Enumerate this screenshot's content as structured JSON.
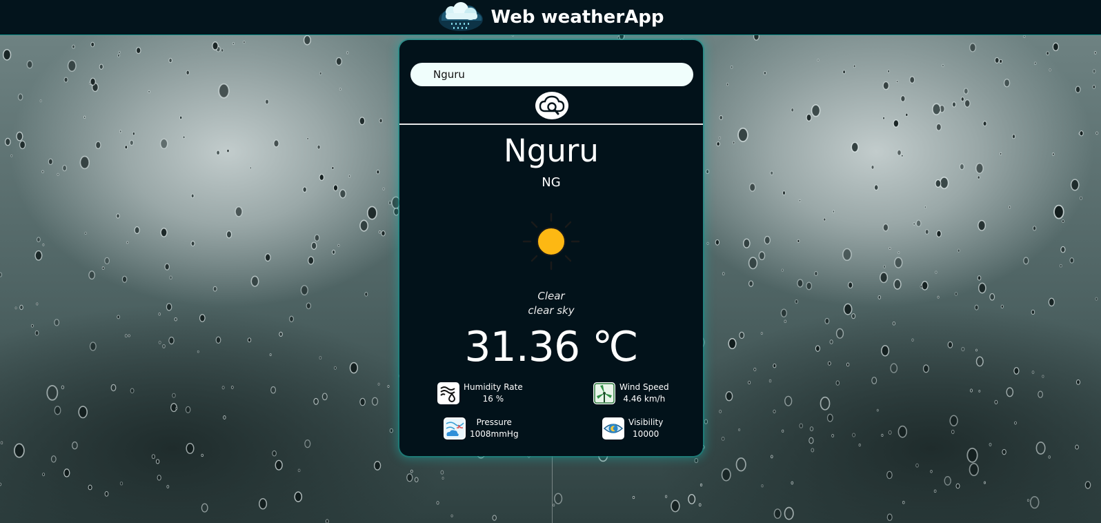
{
  "header": {
    "title": "Web weatherApp",
    "logo_icon": "cloud-rain-icon"
  },
  "search": {
    "value": "Nguru",
    "button_icon": "cloud-search-icon"
  },
  "location": {
    "city": "Nguru",
    "country": "NG"
  },
  "weather": {
    "icon": "sun-icon",
    "main": "Clear",
    "description": "clear sky",
    "temperature": "31.36 ℃"
  },
  "stats": {
    "humidity": {
      "label": "Humidity Rate",
      "value": "16 %",
      "icon": "humidity-icon"
    },
    "wind": {
      "label": "Wind Speed",
      "value": "4.46 km/h",
      "icon": "wind-turbine-icon"
    },
    "pressure": {
      "label": "Pressure",
      "value": "1008mmHg",
      "icon": "pressure-map-icon"
    },
    "visibility": {
      "label": "Visibility",
      "value": "10000",
      "icon": "eye-icon"
    }
  },
  "colors": {
    "topbar": "#03141c",
    "card": "#02121a",
    "accent_glow": "#19aaa5",
    "sun": "#fdb813",
    "search_bg": "#f0fefc"
  }
}
